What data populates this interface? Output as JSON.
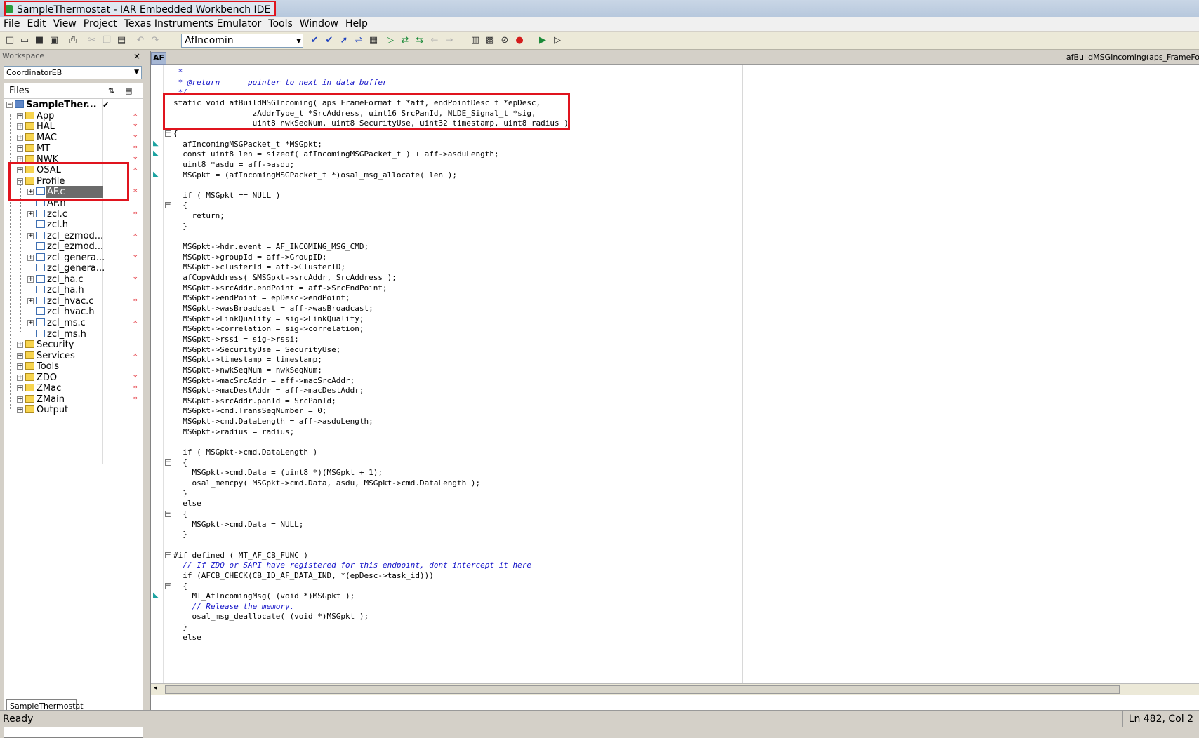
{
  "window": {
    "title": "SampleThermostat - IAR Embedded Workbench IDE"
  },
  "menu": [
    "File",
    "Edit",
    "View",
    "Project",
    "Texas Instruments Emulator",
    "Tools",
    "Window",
    "Help"
  ],
  "toolbar": {
    "find_combo_value": "AfIncomin"
  },
  "workspace": {
    "header": "Workspace",
    "config": "CoordinatorEB",
    "files_header": "Files",
    "project_name": "SampleTher...",
    "tab": "SampleThermostat",
    "tree": [
      {
        "label": "SampleTher...",
        "type": "project",
        "expanded": true,
        "modified": false,
        "checked": true
      },
      {
        "label": "App",
        "type": "folder",
        "expanded": false,
        "modified": true
      },
      {
        "label": "HAL",
        "type": "folder",
        "expanded": false,
        "modified": true
      },
      {
        "label": "MAC",
        "type": "folder",
        "expanded": false,
        "modified": true
      },
      {
        "label": "MT",
        "type": "folder",
        "expanded": false,
        "modified": true
      },
      {
        "label": "NWK",
        "type": "folder",
        "expanded": false,
        "modified": true
      },
      {
        "label": "OSAL",
        "type": "folder",
        "expanded": false,
        "modified": true
      },
      {
        "label": "Profile",
        "type": "folder",
        "expanded": true,
        "modified": false
      },
      {
        "label": "AF.c",
        "type": "c-file",
        "expanded": false,
        "modified": true,
        "selected": true
      },
      {
        "label": "AF.h",
        "type": "h-file",
        "modified": false
      },
      {
        "label": "zcl.c",
        "type": "c-file",
        "expanded": false,
        "modified": true
      },
      {
        "label": "zcl.h",
        "type": "h-file",
        "modified": false
      },
      {
        "label": "zcl_ezmod...",
        "type": "c-file",
        "expanded": false,
        "modified": true
      },
      {
        "label": "zcl_ezmod...",
        "type": "h-file",
        "modified": false
      },
      {
        "label": "zcl_genera...",
        "type": "c-file",
        "expanded": false,
        "modified": true
      },
      {
        "label": "zcl_genera...",
        "type": "h-file",
        "modified": false
      },
      {
        "label": "zcl_ha.c",
        "type": "c-file",
        "expanded": false,
        "modified": true
      },
      {
        "label": "zcl_ha.h",
        "type": "h-file",
        "modified": false
      },
      {
        "label": "zcl_hvac.c",
        "type": "c-file",
        "expanded": false,
        "modified": true
      },
      {
        "label": "zcl_hvac.h",
        "type": "h-file",
        "modified": false
      },
      {
        "label": "zcl_ms.c",
        "type": "c-file",
        "expanded": false,
        "modified": true
      },
      {
        "label": "zcl_ms.h",
        "type": "h-file",
        "modified": false
      },
      {
        "label": "Security",
        "type": "folder",
        "expanded": false,
        "modified": false
      },
      {
        "label": "Services",
        "type": "folder",
        "expanded": false,
        "modified": true
      },
      {
        "label": "Tools",
        "type": "folder",
        "expanded": false,
        "modified": false
      },
      {
        "label": "ZDO",
        "type": "folder",
        "expanded": false,
        "modified": true
      },
      {
        "label": "ZMac",
        "type": "folder",
        "expanded": false,
        "modified": true
      },
      {
        "label": "ZMain",
        "type": "folder",
        "expanded": false,
        "modified": true
      },
      {
        "label": "Output",
        "type": "folder",
        "expanded": false,
        "modified": false
      }
    ]
  },
  "editor": {
    "tab": "AF",
    "function_label": "afBuildMSGIncoming(aps_FrameFo",
    "lines": [
      {
        "text": " *",
        "kind": "comment"
      },
      {
        "text": " * @return      pointer to next in data buffer",
        "kind": "comment"
      },
      {
        "text": " */",
        "kind": "comment"
      },
      {
        "text": "static void afBuildMSGIncoming( aps_FrameFormat_t *aff, endPointDesc_t *epDesc,",
        "kind": "code"
      },
      {
        "text": "                 zAddrType_t *SrcAddress, uint16 SrcPanId, NLDE_Signal_t *sig,",
        "kind": "code"
      },
      {
        "text": "                 uint8 nwkSeqNum, uint8 SecurityUse, uint32 timestamp, uint8 radius )",
        "kind": "code"
      },
      {
        "text": "{",
        "kind": "code"
      },
      {
        "text": "  afIncomingMSGPacket_t *MSGpkt;",
        "kind": "code"
      },
      {
        "text": "  const uint8 len = sizeof( afIncomingMSGPacket_t ) + aff->asduLength;",
        "kind": "code"
      },
      {
        "text": "  uint8 *asdu = aff->asdu;",
        "kind": "code"
      },
      {
        "text": "  MSGpkt = (afIncomingMSGPacket_t *)osal_msg_allocate( len );",
        "kind": "code"
      },
      {
        "text": "",
        "kind": "code"
      },
      {
        "text": "  if ( MSGpkt == NULL )",
        "kind": "code"
      },
      {
        "text": "  {",
        "kind": "code"
      },
      {
        "text": "    return;",
        "kind": "code"
      },
      {
        "text": "  }",
        "kind": "code"
      },
      {
        "text": "",
        "kind": "code"
      },
      {
        "text": "  MSGpkt->hdr.event = AF_INCOMING_MSG_CMD;",
        "kind": "code"
      },
      {
        "text": "  MSGpkt->groupId = aff->GroupID;",
        "kind": "code"
      },
      {
        "text": "  MSGpkt->clusterId = aff->ClusterID;",
        "kind": "code"
      },
      {
        "text": "  afCopyAddress( &MSGpkt->srcAddr, SrcAddress );",
        "kind": "code"
      },
      {
        "text": "  MSGpkt->srcAddr.endPoint = aff->SrcEndPoint;",
        "kind": "code"
      },
      {
        "text": "  MSGpkt->endPoint = epDesc->endPoint;",
        "kind": "code"
      },
      {
        "text": "  MSGpkt->wasBroadcast = aff->wasBroadcast;",
        "kind": "code"
      },
      {
        "text": "  MSGpkt->LinkQuality = sig->LinkQuality;",
        "kind": "code"
      },
      {
        "text": "  MSGpkt->correlation = sig->correlation;",
        "kind": "code"
      },
      {
        "text": "  MSGpkt->rssi = sig->rssi;",
        "kind": "code"
      },
      {
        "text": "  MSGpkt->SecurityUse = SecurityUse;",
        "kind": "code"
      },
      {
        "text": "  MSGpkt->timestamp = timestamp;",
        "kind": "code"
      },
      {
        "text": "  MSGpkt->nwkSeqNum = nwkSeqNum;",
        "kind": "code"
      },
      {
        "text": "  MSGpkt->macSrcAddr = aff->macSrcAddr;",
        "kind": "code"
      },
      {
        "text": "  MSGpkt->macDestAddr = aff->macDestAddr;",
        "kind": "code"
      },
      {
        "text": "  MSGpkt->srcAddr.panId = SrcPanId;",
        "kind": "code"
      },
      {
        "text": "  MSGpkt->cmd.TransSeqNumber = 0;",
        "kind": "code"
      },
      {
        "text": "  MSGpkt->cmd.DataLength = aff->asduLength;",
        "kind": "code"
      },
      {
        "text": "  MSGpkt->radius = radius;",
        "kind": "code"
      },
      {
        "text": "",
        "kind": "code"
      },
      {
        "text": "  if ( MSGpkt->cmd.DataLength )",
        "kind": "code"
      },
      {
        "text": "  {",
        "kind": "code"
      },
      {
        "text": "    MSGpkt->cmd.Data = (uint8 *)(MSGpkt + 1);",
        "kind": "code"
      },
      {
        "text": "    osal_memcpy( MSGpkt->cmd.Data, asdu, MSGpkt->cmd.DataLength );",
        "kind": "code"
      },
      {
        "text": "  }",
        "kind": "code"
      },
      {
        "text": "  else",
        "kind": "code"
      },
      {
        "text": "  {",
        "kind": "code"
      },
      {
        "text": "    MSGpkt->cmd.Data = NULL;",
        "kind": "code"
      },
      {
        "text": "  }",
        "kind": "code"
      },
      {
        "text": "",
        "kind": "code"
      },
      {
        "text": "#if defined ( MT_AF_CB_FUNC )",
        "kind": "code"
      },
      {
        "text": "  // If ZDO or SAPI have registered for this endpoint, dont intercept it here",
        "kind": "comment"
      },
      {
        "text": "  if (AFCB_CHECK(CB_ID_AF_DATA_IND, *(epDesc->task_id)))",
        "kind": "code"
      },
      {
        "text": "  {",
        "kind": "code"
      },
      {
        "text": "    MT_AfIncomingMsg( (void *)MSGpkt );",
        "kind": "code"
      },
      {
        "text": "    // Release the memory.",
        "kind": "comment"
      },
      {
        "text": "    osal_msg_deallocate( (void *)MSGpkt );",
        "kind": "code"
      },
      {
        "text": "  }",
        "kind": "code"
      },
      {
        "text": "  else",
        "kind": "code"
      }
    ]
  },
  "status": {
    "left": "Ready",
    "position": "Ln 482, Col 2"
  }
}
